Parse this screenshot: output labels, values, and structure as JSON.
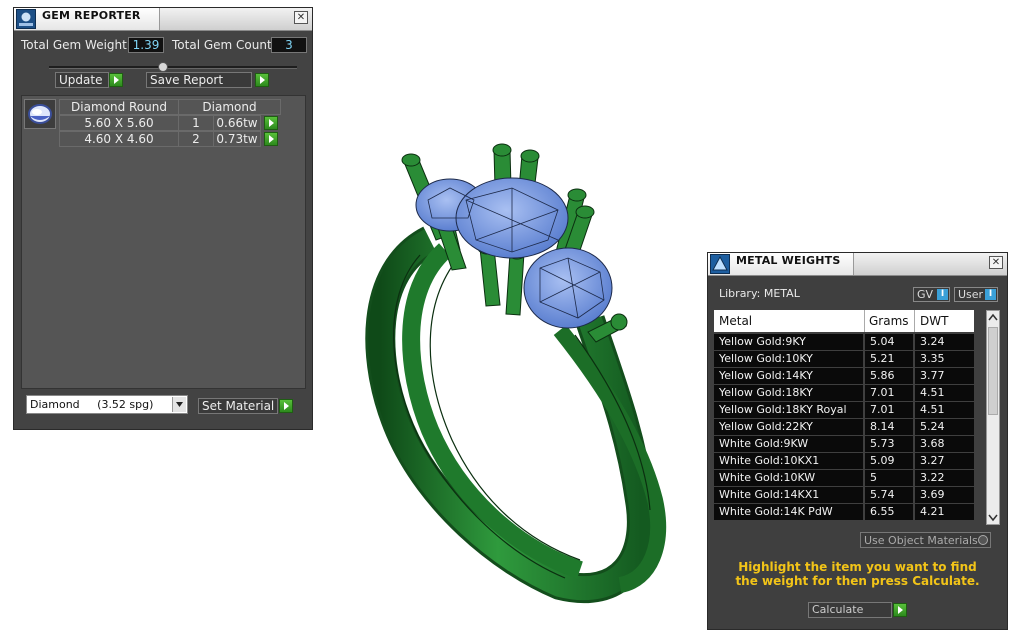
{
  "gem_reporter": {
    "title": "GEM REPORTER",
    "close": "✕",
    "total_weight_label": "Total Gem Weight",
    "total_weight_value": "1.39",
    "total_count_label": "Total Gem Count",
    "total_count_value": "3",
    "update_label": "Update",
    "save_report_label": "Save Report",
    "table": {
      "header_shape": "Diamond Round",
      "header_material": "Diamond",
      "rows": [
        {
          "size": "5.60 X 5.60",
          "count": "1",
          "weight": "0.66tw"
        },
        {
          "size": "4.60 X 4.60",
          "count": "2",
          "weight": "0.73tw"
        }
      ]
    },
    "material_select": "Diamond     (3.52 spg)",
    "set_material_label": "Set Material"
  },
  "metal_weights": {
    "title": "METAL WEIGHTS",
    "close": "✕",
    "library_label": "Library: METAL",
    "gv_label": "GV",
    "user_label": "User",
    "columns": {
      "metal": "Metal",
      "grams": "Grams",
      "dwt": "DWT"
    },
    "rows": [
      {
        "metal": "Yellow Gold:9KY",
        "grams": "5.04",
        "dwt": "3.24"
      },
      {
        "metal": "Yellow Gold:10KY",
        "grams": "5.21",
        "dwt": "3.35"
      },
      {
        "metal": "Yellow Gold:14KY",
        "grams": "5.86",
        "dwt": "3.77"
      },
      {
        "metal": "Yellow Gold:18KY",
        "grams": "7.01",
        "dwt": "4.51"
      },
      {
        "metal": "Yellow Gold:18KY Royal",
        "grams": "7.01",
        "dwt": "4.51"
      },
      {
        "metal": "Yellow Gold:22KY",
        "grams": "8.14",
        "dwt": "5.24"
      },
      {
        "metal": "White Gold:9KW",
        "grams": "5.73",
        "dwt": "3.68"
      },
      {
        "metal": "White Gold:10KX1",
        "grams": "5.09",
        "dwt": "3.27"
      },
      {
        "metal": "White Gold:10KW",
        "grams": "5",
        "dwt": "3.22"
      },
      {
        "metal": "White Gold:14KX1",
        "grams": "5.74",
        "dwt": "3.69"
      },
      {
        "metal": "White Gold:14K PdW",
        "grams": "6.55",
        "dwt": "4.21"
      }
    ],
    "use_object_materials_label": "Use Object Materials",
    "instruction": "Highlight the item you want to find the weight for then press Calculate.",
    "calculate_label": "Calculate"
  },
  "colors": {
    "panel_bg": "#434343",
    "accent_green": "#3aa82a",
    "ring_green": "#1f7a2c",
    "gem_blue": "#7e9fe0",
    "instruction_yellow": "#f2c418",
    "value_cyan": "#7fd4f5"
  }
}
